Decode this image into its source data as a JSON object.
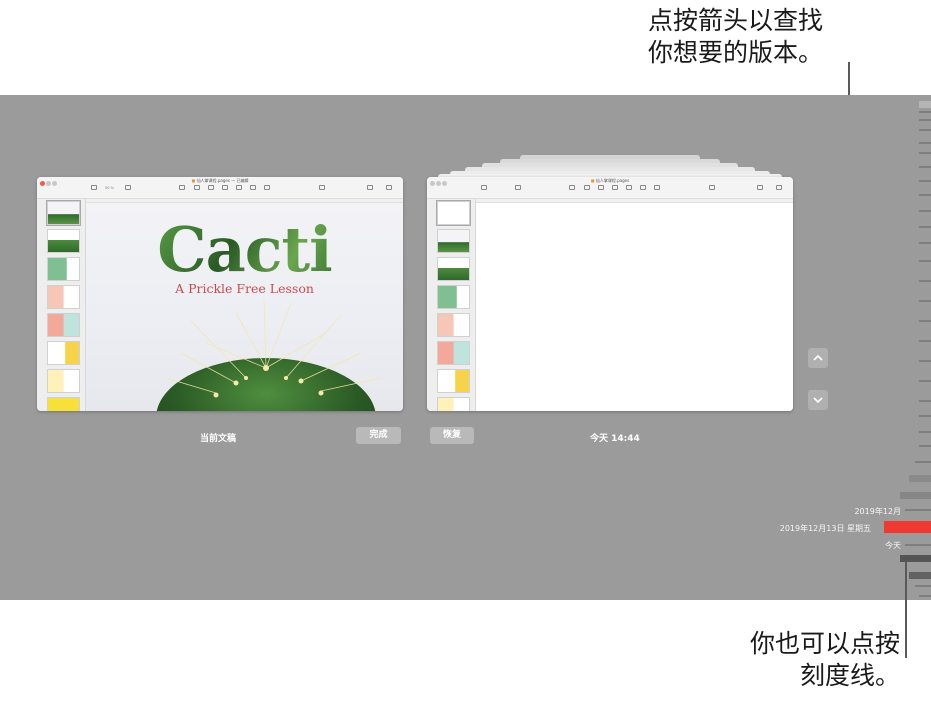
{
  "callouts": {
    "top_line1": "点按箭头以查找",
    "top_line2": "你想要的版本。",
    "bottom_line1": "你也可以点按",
    "bottom_line2": "刻度线。"
  },
  "left_window": {
    "title": "仙人掌课程.pages",
    "title_suffix": "— 已编辑",
    "zoom": "50 %",
    "slide_title": "Cacti",
    "slide_subtitle": "A Prickle Free Lesson"
  },
  "right_window": {
    "title": "仙人掌课程.pages"
  },
  "labels": {
    "current_document": "当前文稿",
    "done_button": "完成",
    "restore_button": "恢复",
    "version_time": "今天 14:44"
  },
  "timeline": {
    "month_label": "2019年12月",
    "date_label": "2019年12月13日 星期五",
    "today_label": "今天"
  },
  "colors": {
    "stage_bg": "#9b9b9b",
    "timeline_red": "#ee3a32",
    "subtitle_red": "#c74d4d"
  }
}
